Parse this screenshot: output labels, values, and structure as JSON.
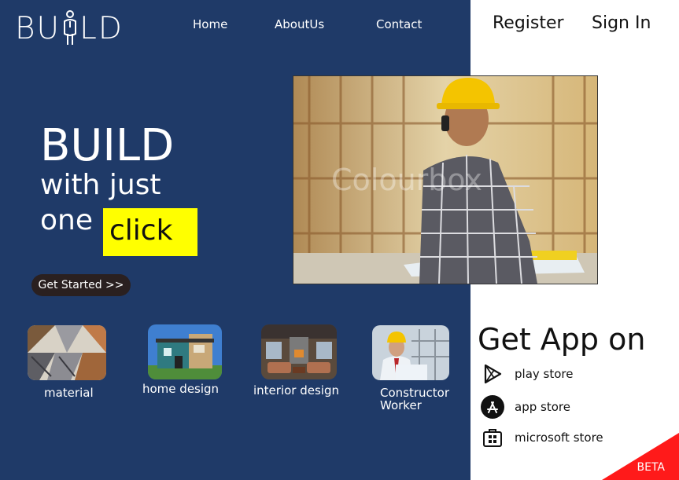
{
  "brand": {
    "logo_text_left": "BU",
    "logo_text_right": "LD"
  },
  "nav": {
    "home": "Home",
    "about": "AboutUs",
    "contact": "Contact"
  },
  "auth": {
    "register": "Register",
    "sign_in": "Sign In"
  },
  "hero": {
    "line1": "BUILD",
    "line2": "with just",
    "line3": "one",
    "highlight": "click",
    "cta": "Get Started >>"
  },
  "categories": [
    {
      "label": "material",
      "icon": "material-photo"
    },
    {
      "label": "home design",
      "icon": "house-photo"
    },
    {
      "label": "interior design",
      "icon": "interior-photo"
    },
    {
      "label_line1": "Constructor",
      "label_line2": "Worker",
      "icon": "worker-photo"
    }
  ],
  "app": {
    "heading": "Get App on",
    "stores": [
      {
        "label": "play store",
        "icon": "play-store-icon"
      },
      {
        "label": "app store",
        "icon": "app-store-icon"
      },
      {
        "label": "microsoft store",
        "icon": "microsoft-store-icon"
      }
    ]
  },
  "badge": "BETA",
  "colors": {
    "primary": "#1f3a68",
    "highlight": "#ffff00",
    "badge": "#ff1a1a",
    "cta_bg": "#2a2020"
  }
}
